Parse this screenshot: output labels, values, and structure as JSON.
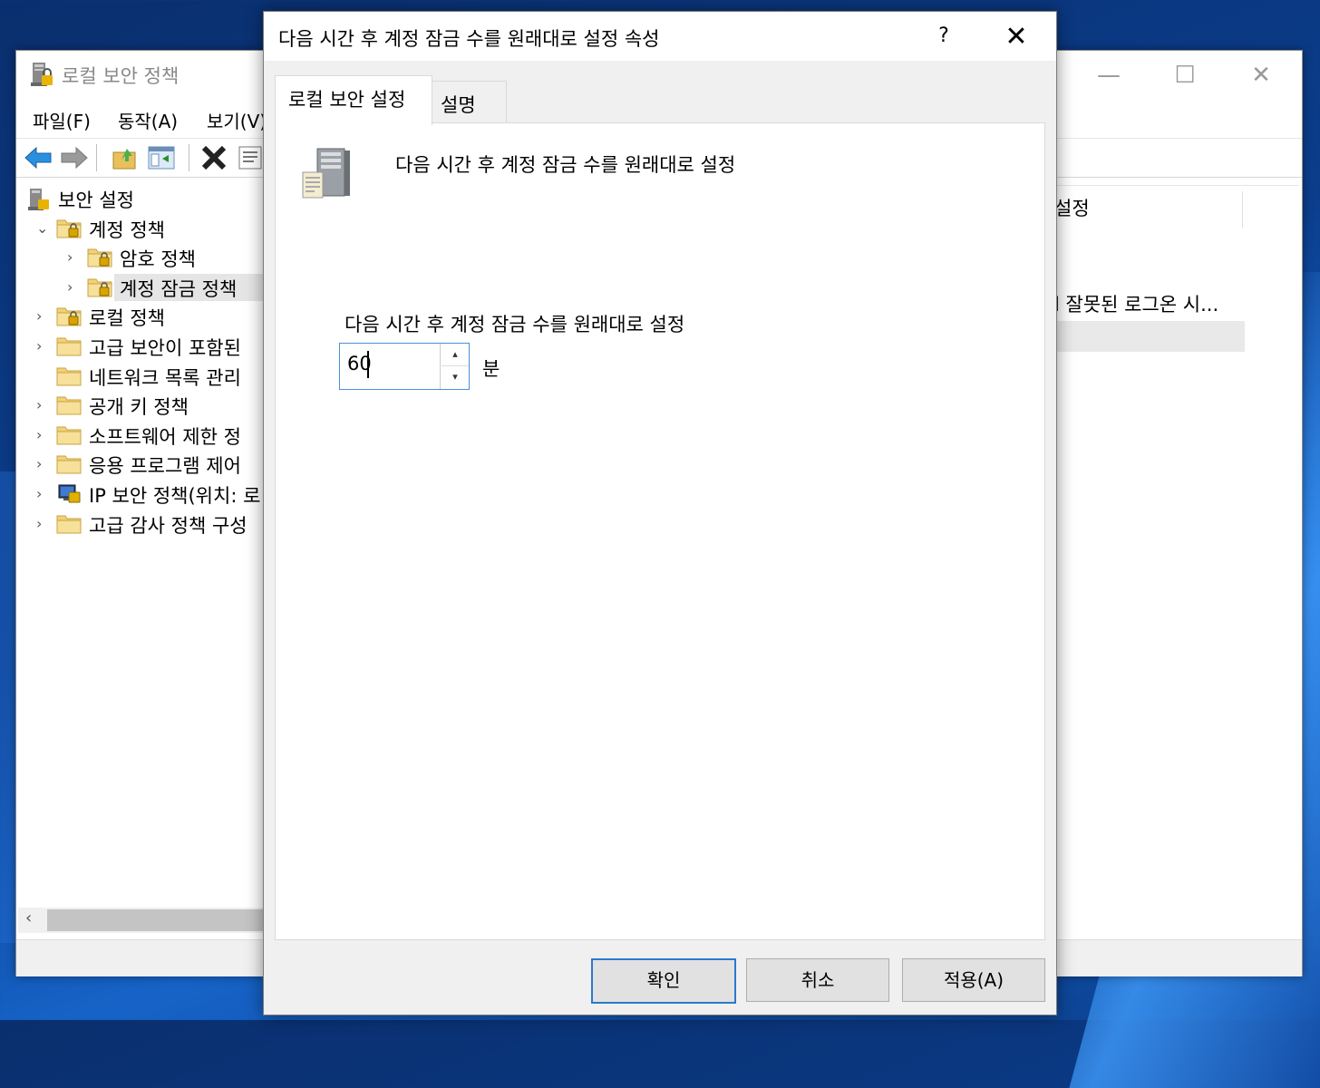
{
  "main_window": {
    "title": "로컬 보안 정책",
    "controls": {
      "minimize": "—",
      "maximize": "☐",
      "close": "✕"
    },
    "menu": [
      "파일(F)",
      "동작(A)",
      "보기(V)"
    ],
    "tree": [
      {
        "label": "보안 설정",
        "level": 0,
        "expander": "",
        "icon": "security-settings-icon"
      },
      {
        "label": "계정 정책",
        "level": 1,
        "expander": "⌄",
        "icon": "locked-folder-icon"
      },
      {
        "label": "암호 정책",
        "level": 2,
        "expander": "›",
        "icon": "locked-folder-icon"
      },
      {
        "label": "계정 잠금 정책",
        "level": 2,
        "expander": "›",
        "icon": "locked-folder-icon",
        "selected": true
      },
      {
        "label": "로컬 정책",
        "level": 1,
        "expander": "›",
        "icon": "locked-folder-icon"
      },
      {
        "label": "고급 보안이 포함된",
        "level": 1,
        "expander": "›",
        "icon": "folder-icon"
      },
      {
        "label": "네트워크 목록 관리",
        "level": 1,
        "expander": "",
        "icon": "folder-icon"
      },
      {
        "label": "공개 키 정책",
        "level": 1,
        "expander": "›",
        "icon": "folder-icon"
      },
      {
        "label": "소프트웨어 제한 정",
        "level": 1,
        "expander": "›",
        "icon": "folder-icon"
      },
      {
        "label": "응용 프로그램 제어",
        "level": 1,
        "expander": "›",
        "icon": "folder-icon"
      },
      {
        "label": "IP 보안 정책(위치: 로",
        "level": 1,
        "expander": "›",
        "icon": "ip-security-icon"
      },
      {
        "label": "고급 감사 정책 구성",
        "level": 1,
        "expander": "›",
        "icon": "folder-icon"
      }
    ],
    "right_pane": {
      "column_header": "설정",
      "row_text": "l 잘못된 로그온 시..."
    },
    "scroll_left": "‹"
  },
  "dialog": {
    "title": "다음 시간 후 계정 잠금 수를 원래대로 설정 속성",
    "help": "?",
    "close": "✕",
    "tabs": [
      "로컬 보안 설정",
      "설명"
    ],
    "heading": "다음 시간 후 계정 잠금 수를 원래대로 설정",
    "field_label": "다음 시간 후 계정 잠금 수를 원래대로 설정",
    "spin": {
      "value": "60",
      "up": "▴",
      "down": "▾"
    },
    "unit": "분",
    "buttons": {
      "ok": "확인",
      "cancel": "취소",
      "apply": "적용(A)"
    }
  }
}
